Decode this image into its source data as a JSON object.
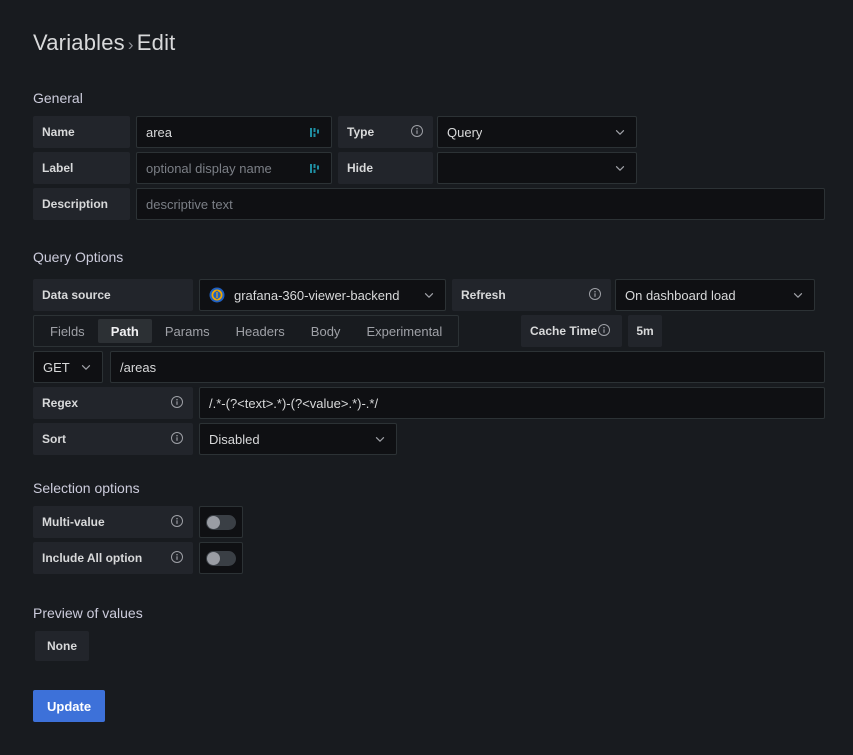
{
  "title": {
    "root": "Variables",
    "separator": "›",
    "current": "Edit"
  },
  "sections": {
    "general": "General",
    "query_options": "Query Options",
    "selection_options": "Selection options",
    "preview": "Preview of values"
  },
  "general": {
    "name_label": "Name",
    "name_value": "area",
    "label_label": "Label",
    "label_placeholder": "optional display name",
    "type_label": "Type",
    "type_value": "Query",
    "hide_label": "Hide",
    "hide_value": "",
    "description_label": "Description",
    "description_placeholder": "descriptive text"
  },
  "query_options": {
    "datasource_label": "Data source",
    "datasource_value": "grafana-360-viewer-backend",
    "refresh_label": "Refresh",
    "refresh_value": "On dashboard load",
    "tabs": [
      {
        "label": "Fields",
        "active": false
      },
      {
        "label": "Path",
        "active": true
      },
      {
        "label": "Params",
        "active": false
      },
      {
        "label": "Headers",
        "active": false
      },
      {
        "label": "Body",
        "active": false
      },
      {
        "label": "Experimental",
        "active": false
      }
    ],
    "cache_time_label": "Cache Time",
    "cache_time_value": "5m",
    "method_value": "GET",
    "path_value": "/areas",
    "regex_label": "Regex",
    "regex_value": "/.*-(?<text>.*)-(?<value>.*)-.*/",
    "sort_label": "Sort",
    "sort_value": "Disabled"
  },
  "selection_options": {
    "multi_value_label": "Multi-value",
    "multi_value_on": false,
    "include_all_label": "Include All option",
    "include_all_on": false
  },
  "preview": {
    "none_label": "None"
  },
  "footer": {
    "update_label": "Update"
  },
  "colors": {
    "accent_blue": "#3d71d9",
    "datasource_icon_ring": "#f2a900",
    "datasource_icon_bg": "#1f60c4",
    "teal_glyph": "#1f8fa3",
    "page_bg": "#181b1f",
    "input_bg": "#0f1013",
    "label_bg": "#22252b",
    "border": "#2c3235",
    "text": "#d8d9da",
    "text_muted": "#7b7f86"
  }
}
